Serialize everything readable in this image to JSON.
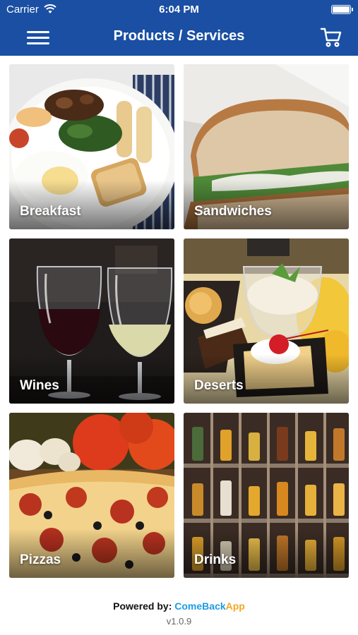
{
  "status_bar": {
    "carrier": "Carrier",
    "time": "6:04 PM"
  },
  "nav": {
    "title": "Products / Services",
    "menu_icon": "hamburger-menu-icon",
    "cart_icon": "shopping-cart-icon"
  },
  "categories": [
    {
      "label": "Breakfast"
    },
    {
      "label": "Sandwiches"
    },
    {
      "label": "Wines"
    },
    {
      "label": "Deserts"
    },
    {
      "label": "Pizzas"
    },
    {
      "label": "Drinks"
    }
  ],
  "footer": {
    "powered_by": "Powered by:",
    "brand_part1": "Come",
    "brand_part2": "Back",
    "brand_part3": "App",
    "version": "v1.0.9"
  },
  "colors": {
    "header_bg": "#1a4fa3",
    "brand_blue": "#1e9be3",
    "brand_orange": "#f5a623"
  }
}
